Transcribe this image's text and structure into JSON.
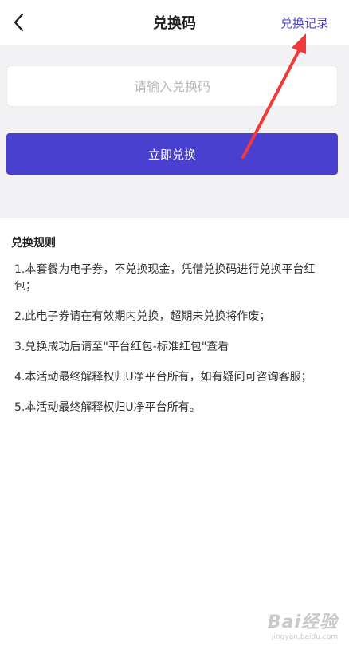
{
  "navbar": {
    "title": "兑换码",
    "history_link": "兑换记录",
    "back_icon": "chevron-left-icon"
  },
  "redeem": {
    "placeholder": "请输入兑换码",
    "button_label": "立即兑换"
  },
  "rules": {
    "title": "兑换规则",
    "items": [
      "1.本套餐为电子券，不兑换现金，凭借兑换码进行兑换平台红包；",
      "2.此电子券请在有效期内兑换，超期未兑换将作废；",
      "3.兑换成功后请至\"平台红包-标准红包\"查看",
      "4.本活动最终解释权归U净平台所有，如有疑问可咨询客服；",
      "5.本活动最终解释权归U净平台所有。"
    ]
  },
  "watermark": {
    "brand": "Bai经验",
    "url": "jingyan.baidu.com"
  },
  "colors": {
    "accent": "#4a40cf",
    "link": "#4b3fd0",
    "section_bg": "#f2f2f4",
    "annotation_arrow": "#f03a3a"
  }
}
